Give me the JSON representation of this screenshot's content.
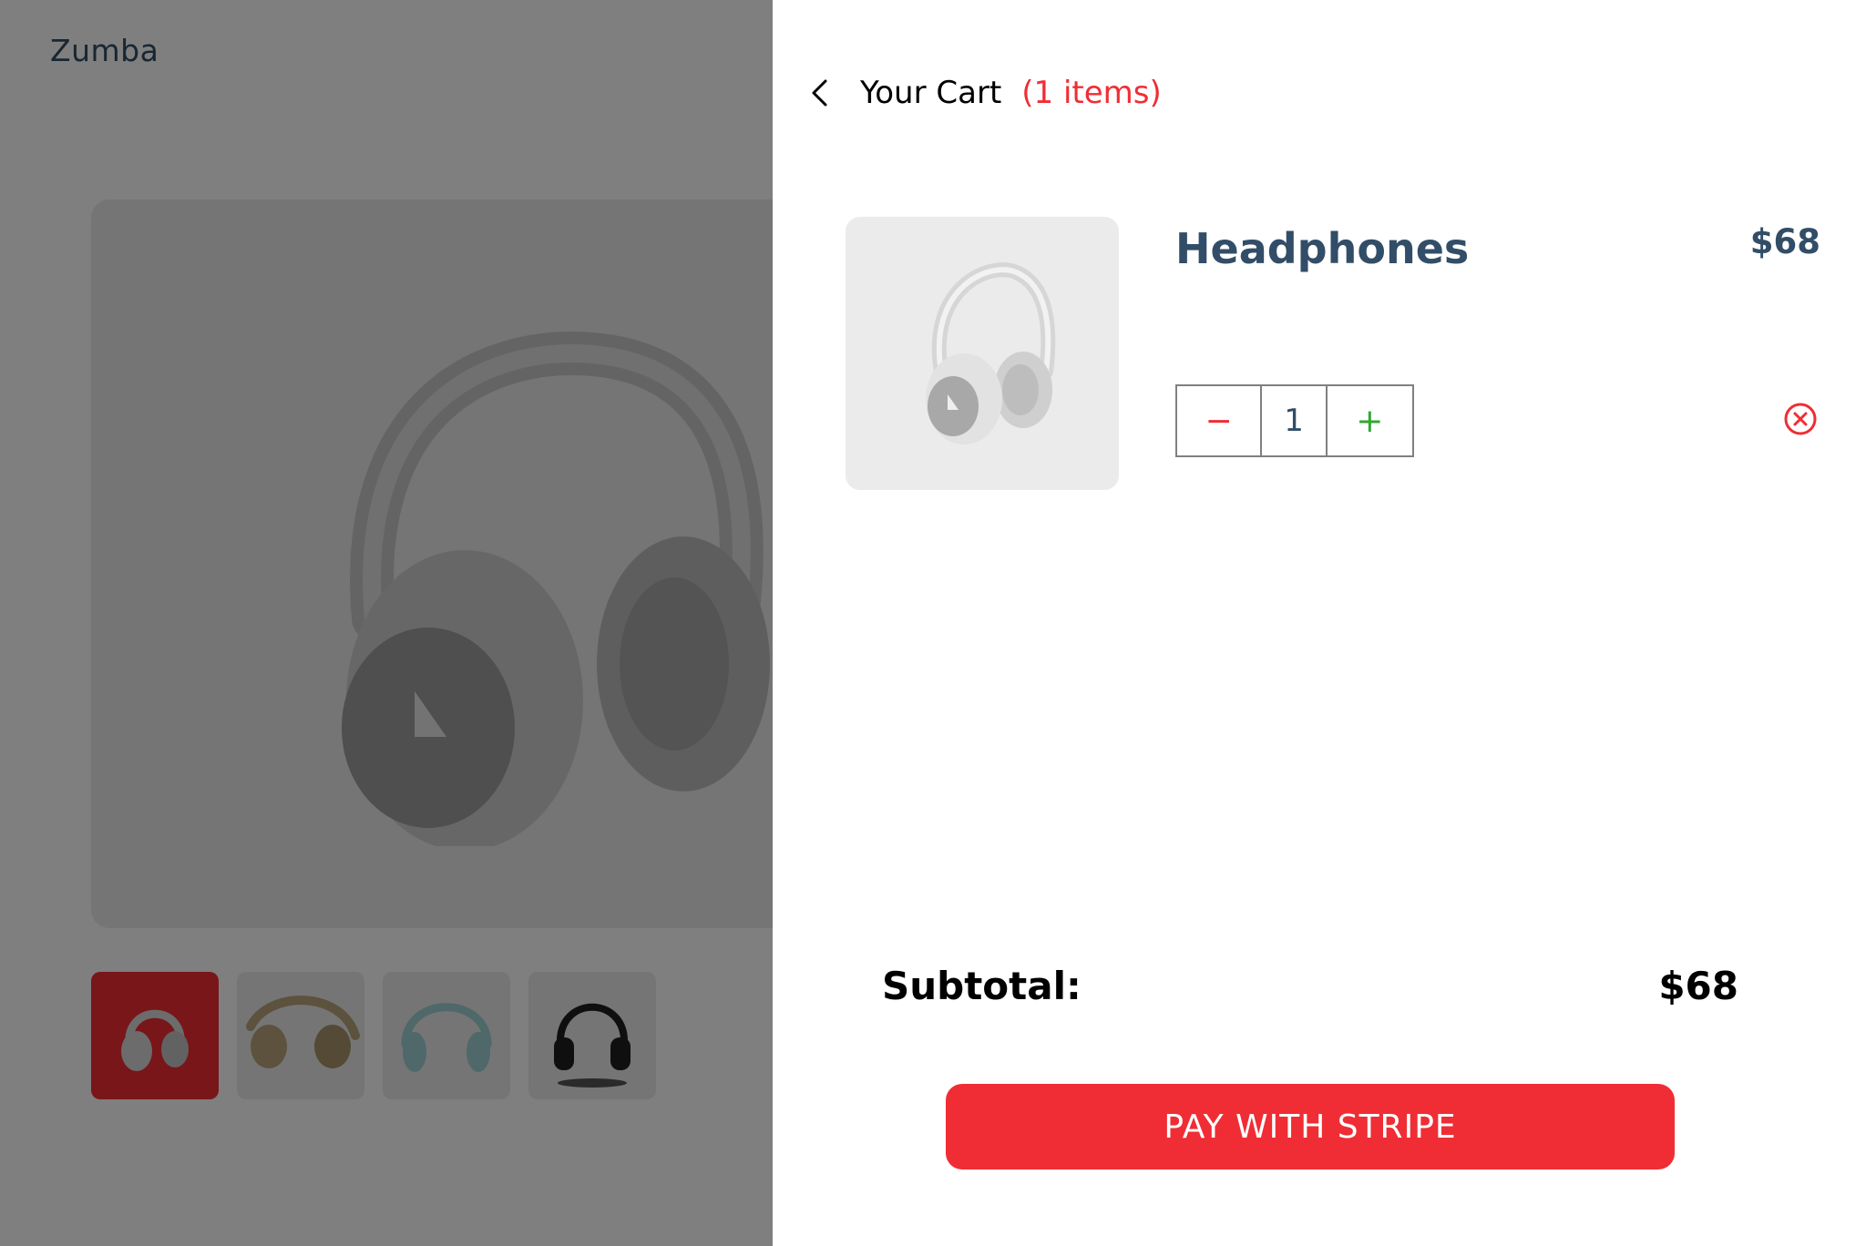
{
  "background_page": {
    "brand": "Zumba",
    "main_image": {
      "icon": "headphones-image",
      "color": "#c8c8c8"
    },
    "thumbnails": [
      {
        "icon": "headphones-white-thumb",
        "color": "#d8d8d8",
        "selected": true
      },
      {
        "icon": "headphones-beige-thumb",
        "color": "#b8a57a",
        "selected": false
      },
      {
        "icon": "headphones-aqua-thumb",
        "color": "#9fd1d3",
        "selected": false
      },
      {
        "icon": "headphones-black-thumb",
        "color": "#1e1e1e",
        "selected": false
      }
    ]
  },
  "cart": {
    "title": "Your Cart",
    "count_label": "(1 items)",
    "items": [
      {
        "name": "Headphones",
        "price": "$68",
        "quantity": "1",
        "decrease_symbol": "−",
        "increase_symbol": "+"
      }
    ],
    "subtotal_label": "Subtotal:",
    "subtotal_value": "$68",
    "pay_button": "PAY WITH STRIPE"
  },
  "colors": {
    "accent": "#f02d34",
    "text_dark": "#324d67",
    "increase": "#31a831",
    "overlay": "rgba(0,0,0,0.5)"
  }
}
